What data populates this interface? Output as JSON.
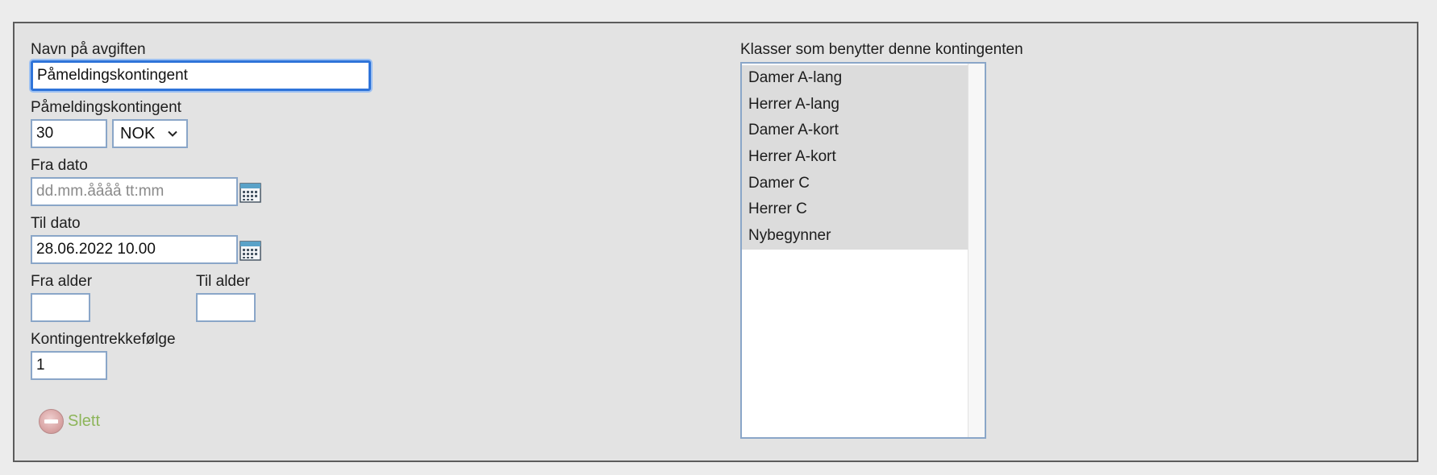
{
  "form": {
    "name_label": "Navn på avgiften",
    "name_value": "Påmeldingskontingent",
    "fee_label": "Påmeldingskontingent",
    "fee_amount": "30",
    "currency": {
      "selected": "NOK",
      "options": [
        "NOK"
      ]
    },
    "from_date_label": "Fra dato",
    "from_date_placeholder": "dd.mm.åååå tt:mm",
    "from_date_value": "",
    "to_date_label": "Til dato",
    "to_date_value": "28.06.2022 10.00",
    "from_age_label": "Fra alder",
    "from_age_value": "",
    "to_age_label": "Til alder",
    "to_age_value": "",
    "order_label": "Kontingentrekkefølge",
    "order_value": "1"
  },
  "classes": {
    "label": "Klasser som benytter denne kontingenten",
    "items": [
      "Damer A-lang",
      "Herrer A-lang",
      "Damer A-kort",
      "Herrer A-kort",
      "Damer C",
      "Herrer C",
      "Nybegynner"
    ]
  },
  "actions": {
    "delete_label": "Slett",
    "delete_icon": "minus-circle-icon",
    "calendar_icon": "calendar-icon"
  },
  "colors": {
    "panel_bg": "#e3e3e3",
    "input_border": "#8aa6c8",
    "focus_border": "#2f74d9",
    "selected_option_bg": "#dcdcdc",
    "delete_text": "#8db55a"
  }
}
